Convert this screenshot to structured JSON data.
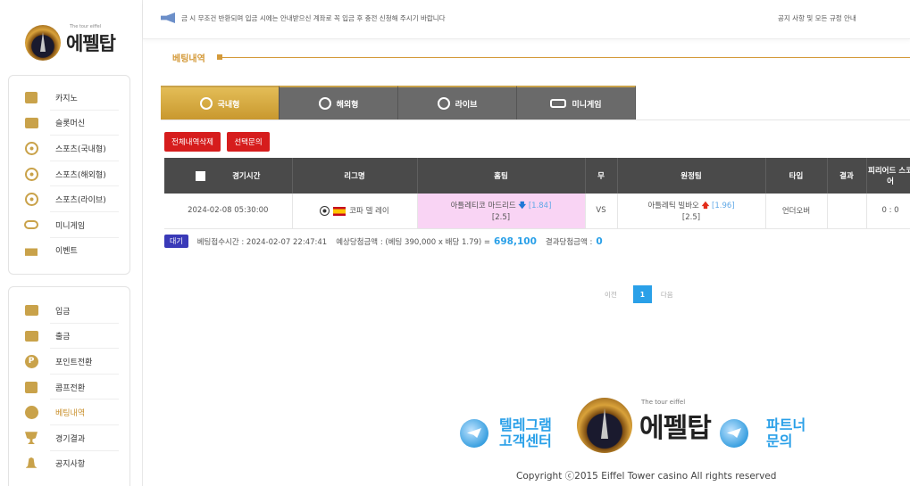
{
  "brand": {
    "logo_text": "에펠탑",
    "logo_tagline": "The tour eiffel"
  },
  "sidebar": {
    "group1": [
      {
        "label": "카지노",
        "icon": "cards-icon"
      },
      {
        "label": "슬롯머신",
        "icon": "slot-icon"
      },
      {
        "label": "스포츠(국내형)",
        "icon": "soccer-ball-icon"
      },
      {
        "label": "스포츠(해외형)",
        "icon": "soccer-ball-icon"
      },
      {
        "label": "스포츠(라이브)",
        "icon": "soccer-ball-icon"
      },
      {
        "label": "미니게임",
        "icon": "gamepad-icon"
      },
      {
        "label": "이벤트",
        "icon": "gift-icon"
      }
    ],
    "group2": [
      {
        "label": "입금",
        "icon": "deposit-icon"
      },
      {
        "label": "출금",
        "icon": "withdraw-icon"
      },
      {
        "label": "포인트전환",
        "icon": "point-icon"
      },
      {
        "label": "콤프전환",
        "icon": "comp-icon"
      },
      {
        "label": "베팅내역",
        "icon": "betting-history-icon",
        "active": true
      },
      {
        "label": "경기결과",
        "icon": "trophy-icon"
      },
      {
        "label": "공지사항",
        "icon": "bell-icon"
      }
    ]
  },
  "topbar": {
    "notice": "금 시 무조건 반환되며 입금 시에는 안내받으신 계좌로 꼭 입금 후 충전 신청해 주시기 바랍니다",
    "rules_link": "공지 사항 및 모든 규정 안내"
  },
  "page": {
    "title": "베팅내역"
  },
  "tabs": [
    {
      "label": "국내형",
      "active": true
    },
    {
      "label": "해외형"
    },
    {
      "label": "라이브"
    },
    {
      "label": "미니게임"
    }
  ],
  "actions": {
    "delete_all": "전체내역삭제",
    "inquire_selected": "선택문의"
  },
  "table": {
    "headers": {
      "time": "경기시간",
      "league": "리그명",
      "home": "홈팀",
      "draw": "무",
      "away": "원정팀",
      "type": "타입",
      "result": "결과",
      "score": "피리어드 스코어"
    },
    "rows": [
      {
        "time": "2024-02-08 05:30:00",
        "league": "코파 델 레이",
        "home_team": "아틀레티코 마드리드",
        "home_odds": "[1.84]",
        "home_handicap": "[2.5]",
        "draw": "VS",
        "away_team": "아틀레틱 빌바오",
        "away_odds": "[1.96]",
        "away_handicap": "[2.5]",
        "type": "언더오버",
        "result": "",
        "score": "0 : 0"
      }
    ]
  },
  "bet_info": {
    "status": "대기",
    "received_label": "베팅접수시간 : 2024-02-07 22:47:41",
    "expected_label": "예상당첨금액 : (베팅 390,000 x 배당 1.79) =",
    "expected_value": "698,100",
    "result_label": "결과당첨금액 :",
    "result_value": "0"
  },
  "pagination": {
    "prev": "이전",
    "current": "1",
    "next": "다음"
  },
  "footer": {
    "telegram_line1": "텔레그램",
    "telegram_line2": "고객센터",
    "partner_line1": "파트너",
    "partner_line2": "문의",
    "copyright": "Copyright ⓒ2015 Eiffel Tower casino All rights reserved"
  },
  "colors": {
    "accent": "#c9a24a",
    "tab_active": "#d6ab45",
    "tab": "#6a6a6a",
    "red": "#d61d1d",
    "blue": "#2aa0e8",
    "table_header": "#4a4a4a",
    "home_highlight": "#f9d4f4"
  }
}
